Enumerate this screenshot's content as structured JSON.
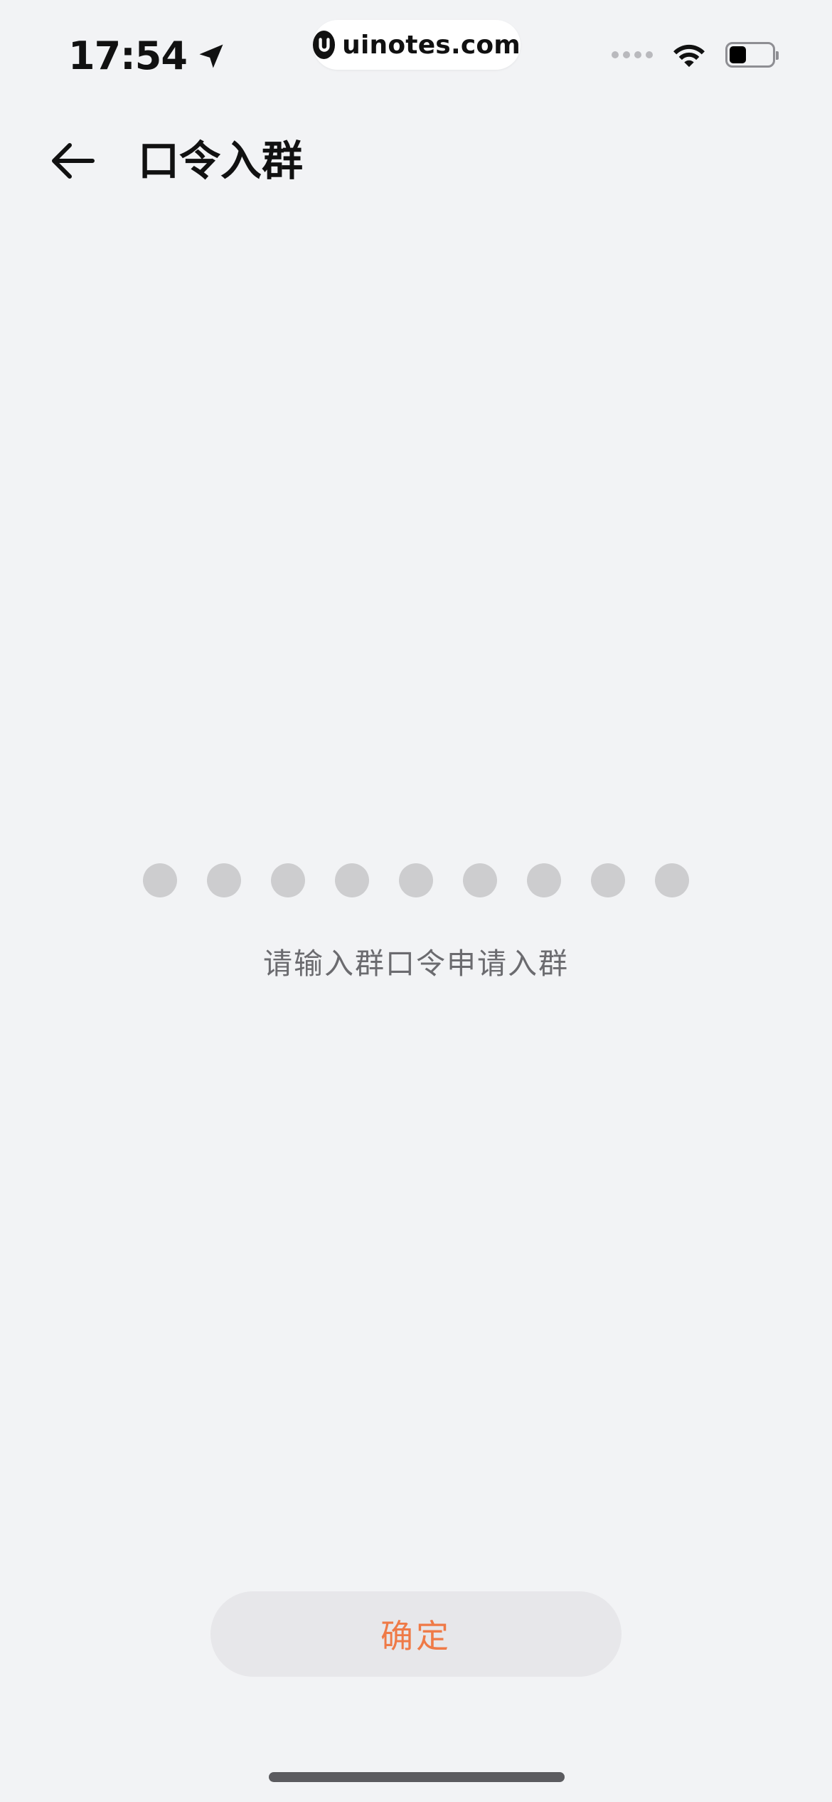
{
  "status_bar": {
    "time": "17:54",
    "location_icon": "location-arrow-icon",
    "wifi_icon": "wifi-icon",
    "battery_icon": "battery-icon",
    "battery_level": 0.4
  },
  "watermark": {
    "text": "uinotes.com"
  },
  "header": {
    "back_icon": "arrow-left-icon",
    "title": "口令入群"
  },
  "code_input": {
    "length": 9,
    "hint": "请输入群口令申请入群"
  },
  "confirm": {
    "label": "确定"
  },
  "colors": {
    "background": "#f2f3f5",
    "accent": "#ef7a47",
    "dot": "#cdcdcf",
    "button_bg": "#e7e7ea"
  }
}
